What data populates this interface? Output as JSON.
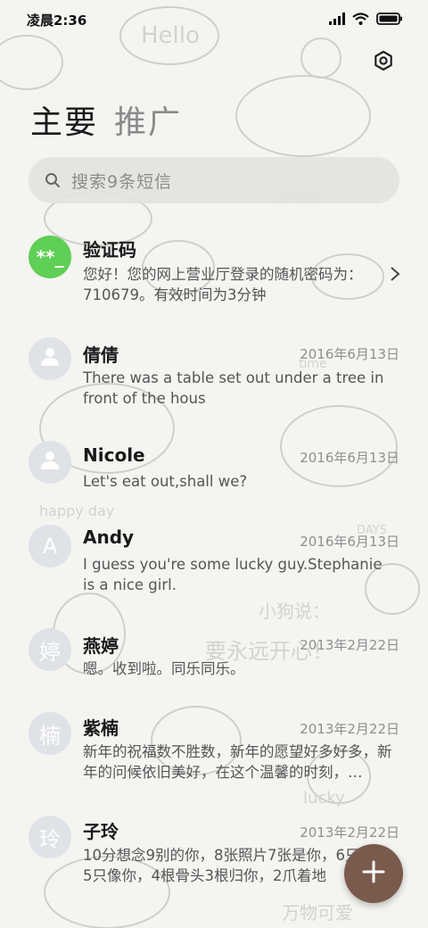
{
  "status_bar": {
    "time": "凌晨2:36"
  },
  "tabs": [
    {
      "label": "主要"
    },
    {
      "label": "推广"
    }
  ],
  "search": {
    "placeholder": "搜索9条短信"
  },
  "conversations": [
    {
      "name": "验证码",
      "avatar_text": "**_",
      "date": "",
      "preview": "您好！您的网上营业厅登录的随机密码为：710679。有效时间为3分钟"
    },
    {
      "name": "倩倩",
      "avatar_text": "",
      "date": "2016年6月13日",
      "preview": "There was a table set out under a tree in front of the hous"
    },
    {
      "name": "Nicole",
      "avatar_text": "",
      "date": "2016年6月13日",
      "preview": "Let's eat out,shall we?"
    },
    {
      "name": "Andy",
      "avatar_text": "A",
      "date": "2016年6月13日",
      "preview": "I guess you're some lucky guy.Stephanie is a nice girl."
    },
    {
      "name": "燕婷",
      "avatar_text": "婷",
      "date": "2013年2月22日",
      "preview": "嗯。收到啦。同乐同乐。"
    },
    {
      "name": "紫楠",
      "avatar_text": "楠",
      "date": "2013年2月22日",
      "preview": "新年的祝福数不胜数，新年的愿望好多好多，新年的问候依旧美好，在这个温馨的时刻，…"
    },
    {
      "name": "子玲",
      "avatar_text": "玲",
      "date": "2013年2月22日",
      "preview": "10分想念9别的你，8张照片7张是你，6只小狗5只像你，4根骨头3根归你，2爪着地"
    }
  ],
  "background_doodle_text": [
    "Hello",
    "puppy~",
    "time",
    "happy day",
    "DAYS",
    "小狗说：",
    "要永远开心！",
    "lucky",
    "万物可爱"
  ],
  "colors": {
    "accent_green": "#5fcf55",
    "fab": "#7a5a4c",
    "avatar_bg": "#dfe2e7"
  },
  "icons": {
    "settings": "settings-icon",
    "search": "search-icon",
    "chevron": "chevron-right-icon",
    "fab": "plus-icon",
    "avatar_placeholder": "person-icon"
  }
}
